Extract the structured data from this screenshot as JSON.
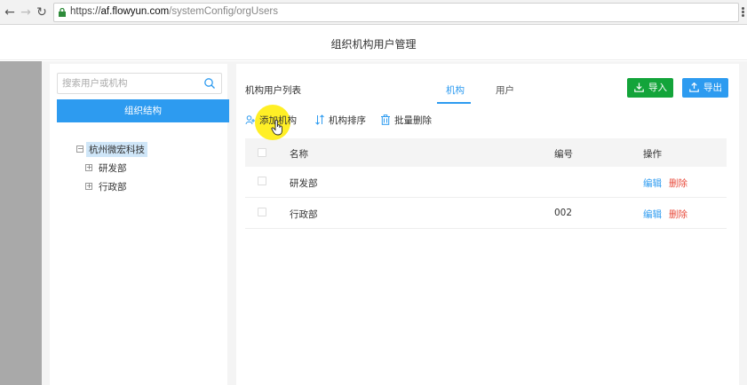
{
  "browser": {
    "url_scheme": "https://",
    "url_host": "af.flowyun.com",
    "url_path": "/systemConfig/orgUsers"
  },
  "header": {
    "title": "组织机构用户管理"
  },
  "left_panel": {
    "search_placeholder": "搜索用户或机构",
    "org_tab_label": "组织结构",
    "tree": {
      "root": {
        "label": "杭州微宏科技",
        "toggle": "−"
      },
      "children": [
        {
          "label": "研发部",
          "toggle": "+"
        },
        {
          "label": "行政部",
          "toggle": "+"
        }
      ]
    }
  },
  "right_panel": {
    "title": "机构用户列表",
    "tabs": [
      {
        "label": "机构",
        "active": true
      },
      {
        "label": "用户",
        "active": false
      }
    ],
    "import_label": "导入",
    "export_label": "导出",
    "toolbar": {
      "add_label": "添加机构",
      "sort_label": "机构排序",
      "batch_delete_label": "批量删除"
    },
    "table": {
      "columns": [
        "名称",
        "编号",
        "操作"
      ],
      "rows": [
        {
          "name": "研发部",
          "code": "",
          "edit": "编辑",
          "delete": "删除"
        },
        {
          "name": "行政部",
          "code": "002",
          "edit": "编辑",
          "delete": "删除"
        }
      ]
    }
  },
  "colors": {
    "primary": "#2d9bf0",
    "import_green": "#13a43a",
    "danger": "#e84c3d",
    "cursor_highlight": "#ffec00"
  }
}
